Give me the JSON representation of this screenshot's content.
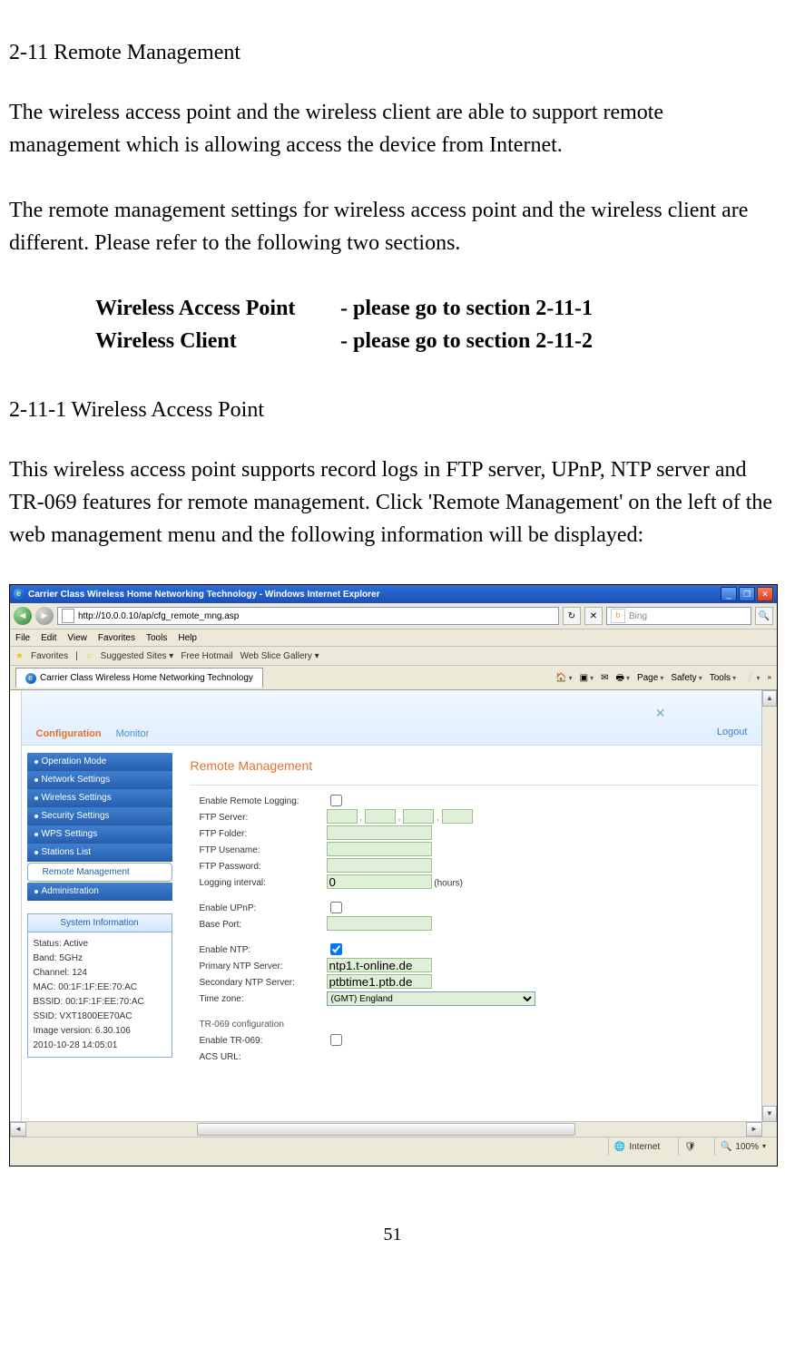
{
  "doc": {
    "heading1": "2-11 Remote Management",
    "para1": "The wireless access point and the wireless client are able to support remote management which is allowing access the device from Internet.",
    "para2": "The remote management settings for wireless access point and the wireless client are different. Please refer to the following two sections.",
    "ref": {
      "row1_col1": "Wireless Access Point",
      "row1_col2": "- please go to section 2-11-1",
      "row2_col1": "Wireless Client",
      "row2_col2": "- please go to section 2-11-2"
    },
    "heading2": "2-11-1 Wireless Access Point",
    "para3": "This wireless access point supports record logs in FTP server, UPnP, NTP server and TR-069 features for remote management. Click 'Remote Management' on the left of the web management menu and the following information will be displayed:",
    "page_number": "51"
  },
  "browser": {
    "title": "Carrier Class Wireless Home Networking Technology - Windows Internet Explorer",
    "url": "http://10.0.0.10/ap/cfg_remote_mng.asp",
    "search_placeholder": "Bing",
    "menus": [
      "File",
      "Edit",
      "View",
      "Favorites",
      "Tools",
      "Help"
    ],
    "favbar": {
      "label": "Favorites",
      "items": [
        "Suggested Sites",
        "Free Hotmail",
        "Web Slice Gallery"
      ]
    },
    "tab_title": "Carrier Class Wireless Home Networking Technology",
    "toolbar": [
      "Page",
      "Safety",
      "Tools"
    ],
    "banner_tabs": {
      "active": "Configuration",
      "other": "Monitor"
    },
    "logout": "Logout",
    "sidebar_nav": [
      "Operation Mode",
      "Network Settings",
      "Wireless Settings",
      "Security Settings",
      "WPS Settings",
      "Stations List",
      "Remote Management",
      "Administration"
    ],
    "sidebar_selected_index": 6,
    "sysinfo": {
      "header": "System Information",
      "rows": [
        "Status: Active",
        "Band: 5GHz",
        "Channel: 124",
        "MAC: 00:1F:1F:EE:70:AC",
        "BSSID: 00:1F:1F:EE:70:AC",
        "SSID: VXT1800EE70AC",
        "Image version: 6.30.106",
        "2010-10-28 14:05:01"
      ]
    },
    "panel": {
      "title": "Remote Management",
      "rows": {
        "enable_remote_logging": "Enable Remote Logging:",
        "ftp_server": "FTP Server:",
        "ftp_folder": "FTP Folder:",
        "ftp_username": "FTP Usename:",
        "ftp_password": "FTP Password:",
        "logging_interval": "Logging interval:",
        "logging_interval_value": "0",
        "logging_interval_unit": "(hours)",
        "enable_upnp": "Enable UPnP:",
        "base_port": "Base Port:",
        "enable_ntp": "Enable NTP:",
        "primary_ntp": "Primary NTP Server:",
        "primary_ntp_value": "ntp1.t-online.de",
        "secondary_ntp": "Secondary NTP Server:",
        "secondary_ntp_value": "ptbtime1.ptb.de",
        "time_zone": "Time zone:",
        "time_zone_value": "(GMT) England",
        "tr069_section": "TR-069 configuration",
        "enable_tr069": "Enable TR-069:",
        "acs_url": "ACS URL:"
      }
    },
    "statusbar": {
      "zone": "Internet",
      "zoom": "100%"
    }
  }
}
